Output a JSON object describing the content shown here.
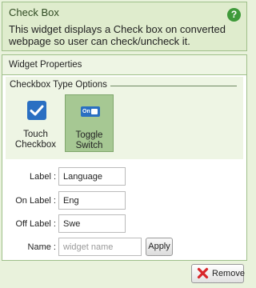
{
  "header": {
    "title": "Check Box",
    "help_icon": "?",
    "description": "This widget displays a Check box on converted webpage so user can check/uncheck it."
  },
  "panel": {
    "title": "Widget Properties",
    "type_options": {
      "legend": "Checkbox Type Options",
      "options": [
        {
          "label_line1": "Touch",
          "label_line2": "Checkbox",
          "selected": false
        },
        {
          "label_line1": "Toggle",
          "label_line2": "Switch",
          "icon_text": "On",
          "selected": true
        }
      ]
    },
    "fields": {
      "label": {
        "label": "Label :",
        "value": "Language"
      },
      "on_label": {
        "label": "On Label :",
        "value": "Eng"
      },
      "off_label": {
        "label": "Off Label :",
        "value": "Swe"
      },
      "name": {
        "label": "Name :",
        "value": "",
        "placeholder": "widget name"
      }
    },
    "apply_label": "Apply"
  },
  "remove_label": "Remove",
  "colors": {
    "background": "#e9f2dc",
    "border": "#9fc08a",
    "selected_option": "#a6c893",
    "icon_blue": "#2a6fc2",
    "remove_red": "#d8262a"
  }
}
